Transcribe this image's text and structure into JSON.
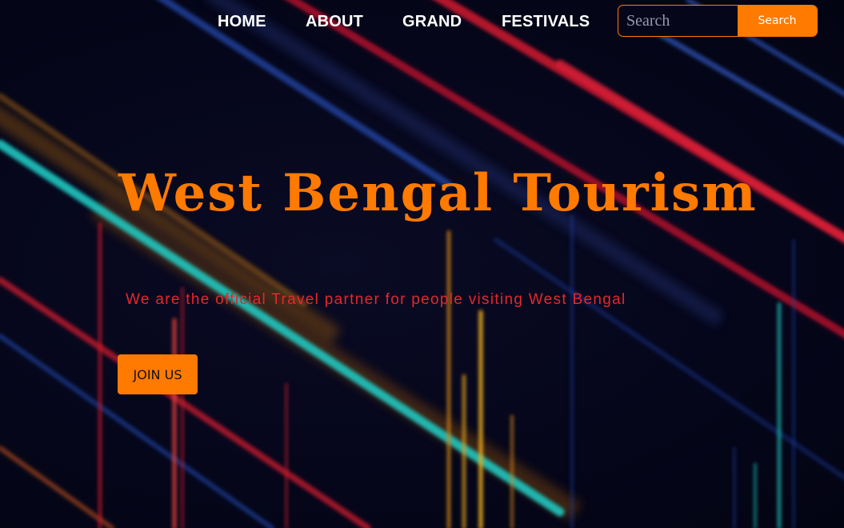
{
  "nav": {
    "items": [
      {
        "label": "HOME"
      },
      {
        "label": "ABOUT"
      },
      {
        "label": "GRAND"
      },
      {
        "label": "FESTIVALS"
      }
    ]
  },
  "search": {
    "placeholder": "Search",
    "button_label": "Search"
  },
  "hero": {
    "title": "West Bengal Tourism",
    "subtitle": "We are the official Travel partner for people visiting West Bengal",
    "cta_label": "JOIN US"
  },
  "colors": {
    "accent": "#ff7a00",
    "subtitle": "#e8262a",
    "background": "#05061a"
  }
}
